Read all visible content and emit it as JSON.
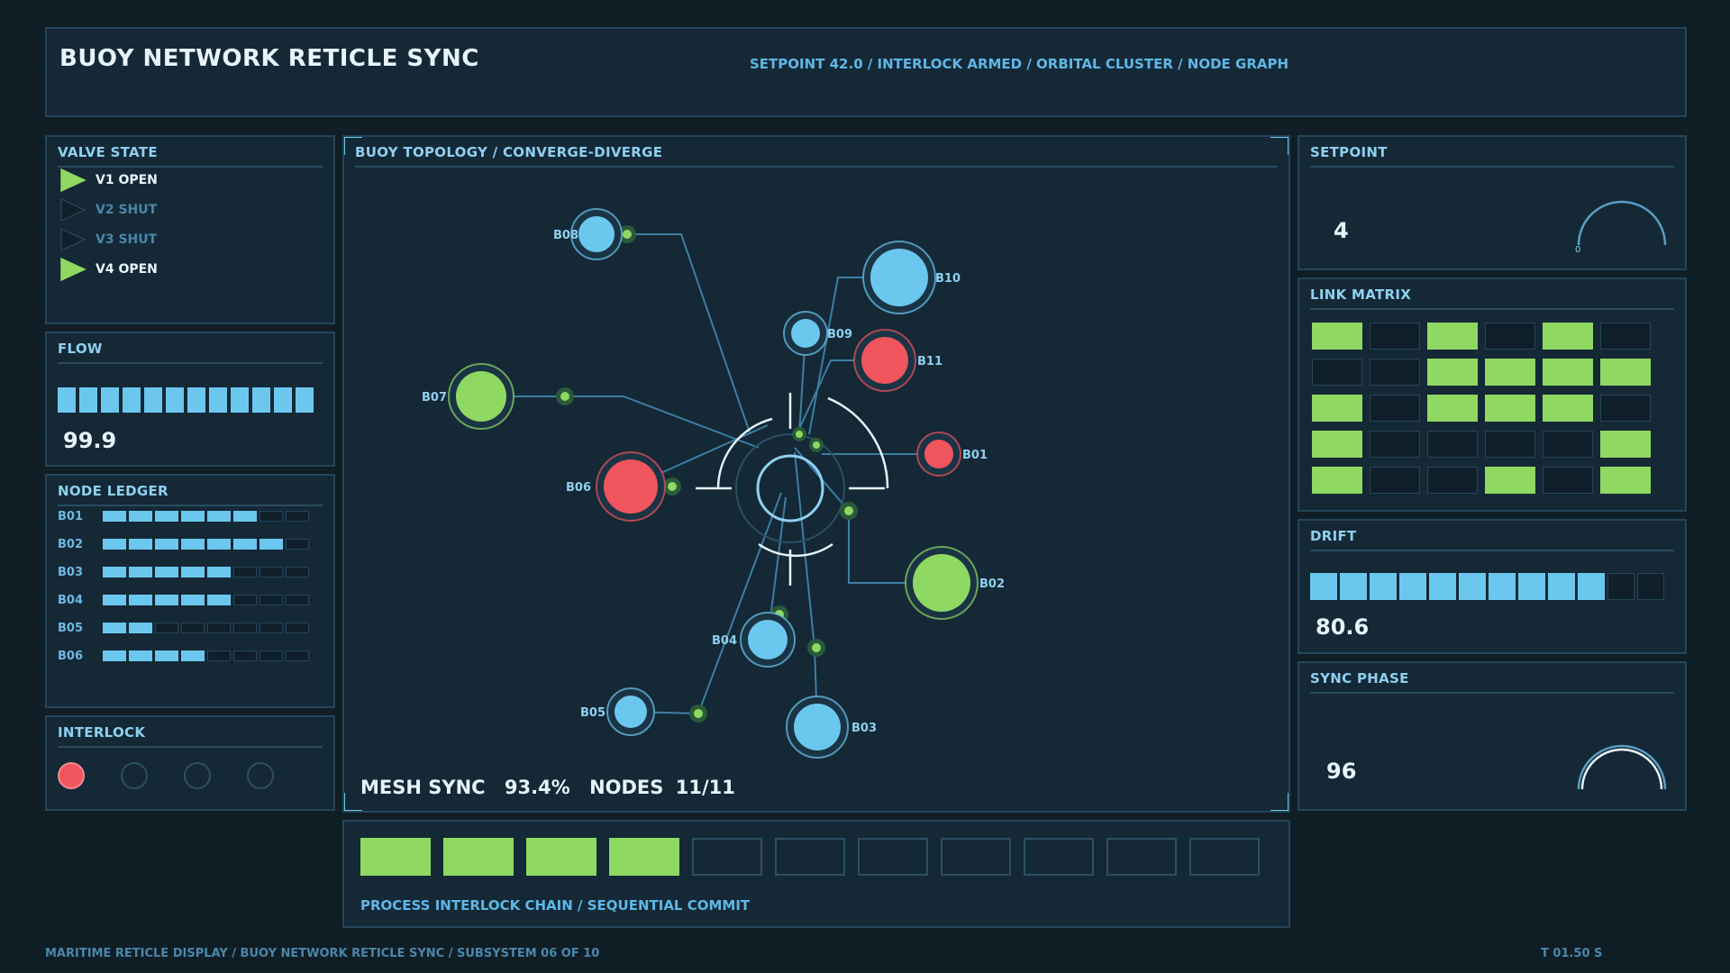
{
  "header": {
    "title": "BUOY NETWORK RETICLE SYNC",
    "subtitle": "SETPOINT 42.0 / INTERLOCK ARMED / ORBITAL CLUSTER / NODE GRAPH"
  },
  "valve_state": {
    "title": "VALVE STATE",
    "items": [
      {
        "label": "V1 OPEN",
        "open": true
      },
      {
        "label": "V2 SHUT",
        "open": false
      },
      {
        "label": "V3 SHUT",
        "open": false
      },
      {
        "label": "V4 OPEN",
        "open": true
      }
    ]
  },
  "flow": {
    "title": "FLOW",
    "value": "99.9",
    "segments_on": 12,
    "segments_total": 12
  },
  "node_ledger": {
    "title": "NODE LEDGER",
    "rows": [
      {
        "label": "B01",
        "filled": 6,
        "total": 8
      },
      {
        "label": "B02",
        "filled": 7,
        "total": 8
      },
      {
        "label": "B03",
        "filled": 5,
        "total": 8
      },
      {
        "label": "B04",
        "filled": 5,
        "total": 8
      },
      {
        "label": "B05",
        "filled": 2,
        "total": 8
      },
      {
        "label": "B06",
        "filled": 4,
        "total": 8
      }
    ]
  },
  "interlock": {
    "title": "INTERLOCK",
    "states": [
      true,
      false,
      false,
      false
    ],
    "on_color": "#f0545c"
  },
  "topology": {
    "title": "BUOY TOPOLOGY / CONVERGE-DIVERGE",
    "mesh_sync_label": "MESH SYNC",
    "mesh_sync_value": "93.4%",
    "nodes_label": "NODES",
    "nodes_value": "11/11",
    "nodes": [
      {
        "id": "B08",
        "color": "blue"
      },
      {
        "id": "B10",
        "color": "blue"
      },
      {
        "id": "B09",
        "color": "blue"
      },
      {
        "id": "B11",
        "color": "red"
      },
      {
        "id": "B07",
        "color": "green"
      },
      {
        "id": "B01",
        "color": "red"
      },
      {
        "id": "B06",
        "color": "red"
      },
      {
        "id": "B04",
        "color": "blue"
      },
      {
        "id": "B02",
        "color": "green"
      },
      {
        "id": "B05",
        "color": "blue"
      },
      {
        "id": "B03",
        "color": "blue"
      }
    ]
  },
  "chain": {
    "label": "PROCESS INTERLOCK CHAIN / SEQUENTIAL COMMIT",
    "steps_done": 4,
    "steps_total": 11
  },
  "setpoint": {
    "title": "SETPOINT",
    "value": "4",
    "gauge_label": "0"
  },
  "link_matrix": {
    "title": "LINK MATRIX",
    "rows": [
      [
        1,
        0,
        1,
        0,
        1,
        0
      ],
      [
        0,
        0,
        1,
        1,
        1,
        1
      ],
      [
        1,
        0,
        1,
        1,
        1,
        0
      ],
      [
        1,
        0,
        0,
        0,
        0,
        1
      ],
      [
        1,
        0,
        0,
        1,
        0,
        1
      ]
    ]
  },
  "drift": {
    "title": "DRIFT",
    "value": "80.6",
    "segments_on": 10,
    "segments_total": 12
  },
  "sync_phase": {
    "title": "SYNC PHASE",
    "value": "96"
  },
  "footer": {
    "left": "MARITIME RETICLE DISPLAY / BUOY NETWORK RETICLE SYNC / SUBSYSTEM 06 OF 10",
    "right": "T 01.50 S"
  },
  "colors": {
    "accent_blue": "#6cc7ef",
    "accent_green": "#8fd862",
    "accent_red": "#f0545c",
    "panel_bg": "#142836"
  }
}
